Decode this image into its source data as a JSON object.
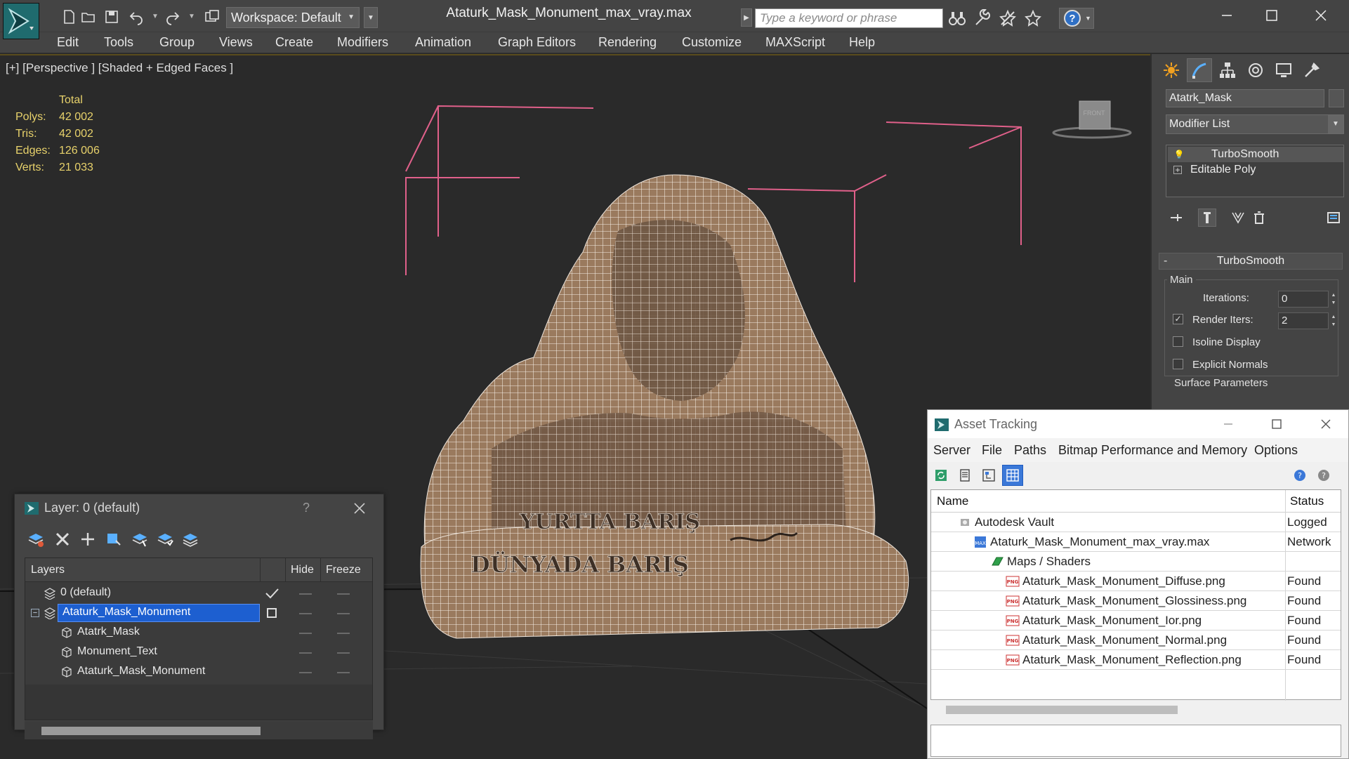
{
  "window": {
    "title": "Ataturk_Mask_Monument_max_vray.max",
    "workspace_label": "Workspace: Default",
    "search_placeholder": "Type a keyword or phrase"
  },
  "menu": [
    "Edit",
    "Tools",
    "Group",
    "Views",
    "Create",
    "Modifiers",
    "Animation",
    "Graph Editors",
    "Rendering",
    "Customize",
    "MAXScript",
    "Help"
  ],
  "viewport": {
    "label": "[+] [Perspective ] [Shaded + Edged Faces ]",
    "stats_header": "Total",
    "stats": [
      {
        "label": "Polys:",
        "value": "42 002"
      },
      {
        "label": "Tris:",
        "value": "42 002"
      },
      {
        "label": "Edges:",
        "value": "126 006"
      },
      {
        "label": "Verts:",
        "value": "21 033"
      }
    ],
    "viewcube_label": "FRONT",
    "monument_text_line1": "YURTTA BARIŞ",
    "monument_text_line2": "DÜNYADA BARIŞ"
  },
  "command_panel": {
    "object_name": "Atatrk_Mask",
    "modifier_list_label": "Modifier List",
    "stack": [
      {
        "label": "TurboSmooth",
        "selected": true
      },
      {
        "label": "Editable Poly",
        "selected": false
      }
    ],
    "turbosmooth": {
      "title": "TurboSmooth",
      "main_label": "Main",
      "iterations_label": "Iterations:",
      "iterations_value": "0",
      "render_iters_label": "Render Iters:",
      "render_iters_value": "2",
      "render_iters_checked": true,
      "isoline_label": "Isoline Display",
      "explicit_normals_label": "Explicit Normals",
      "surface_params_label": "Surface Parameters"
    }
  },
  "layer_explorer": {
    "title": "Layer: 0 (default)",
    "help": "?",
    "columns": [
      "Layers",
      "Hide",
      "Freeze"
    ],
    "rows": [
      {
        "name": "0 (default)",
        "level": 0,
        "selected": false,
        "active": true
      },
      {
        "name": "Ataturk_Mask_Monument",
        "level": 0,
        "selected": true,
        "active": false
      },
      {
        "name": "Atatrk_Mask",
        "level": 1,
        "selected": false,
        "active": false
      },
      {
        "name": "Monument_Text",
        "level": 1,
        "selected": false,
        "active": false
      },
      {
        "name": "Ataturk_Mask_Monument",
        "level": 1,
        "selected": false,
        "active": false
      }
    ]
  },
  "asset_tracking": {
    "title": "Asset Tracking",
    "menu": [
      "Server",
      "File",
      "Paths",
      "Bitmap Performance and Memory",
      "Options"
    ],
    "columns": [
      "Name",
      "Status"
    ],
    "rows": [
      {
        "name": "Autodesk Vault",
        "status": "Logged",
        "level": 1,
        "icon": "vault-icon"
      },
      {
        "name": "Ataturk_Mask_Monument_max_vray.max",
        "status": "Network",
        "level": 2,
        "icon": "max-file-icon"
      },
      {
        "name": "Maps / Shaders",
        "status": "",
        "level": 3,
        "icon": "maps-icon"
      },
      {
        "name": "Ataturk_Mask_Monument_Diffuse.png",
        "status": "Found",
        "level": 4,
        "icon": "png-icon"
      },
      {
        "name": "Ataturk_Mask_Monument_Glossiness.png",
        "status": "Found",
        "level": 4,
        "icon": "png-icon"
      },
      {
        "name": "Ataturk_Mask_Monument_Ior.png",
        "status": "Found",
        "level": 4,
        "icon": "png-icon"
      },
      {
        "name": "Ataturk_Mask_Monument_Normal.png",
        "status": "Found",
        "level": 4,
        "icon": "png-icon"
      },
      {
        "name": "Ataturk_Mask_Monument_Reflection.png",
        "status": "Found",
        "level": 4,
        "icon": "png-icon"
      }
    ]
  },
  "colors": {
    "ui_dark": "#444444",
    "viewport_bg": "#2a2a2a",
    "stat_text": "#e8d26b",
    "selection_blue": "#1d5fd0",
    "bbox_pink": "#e0608a",
    "stone": "#8a6a4f"
  }
}
